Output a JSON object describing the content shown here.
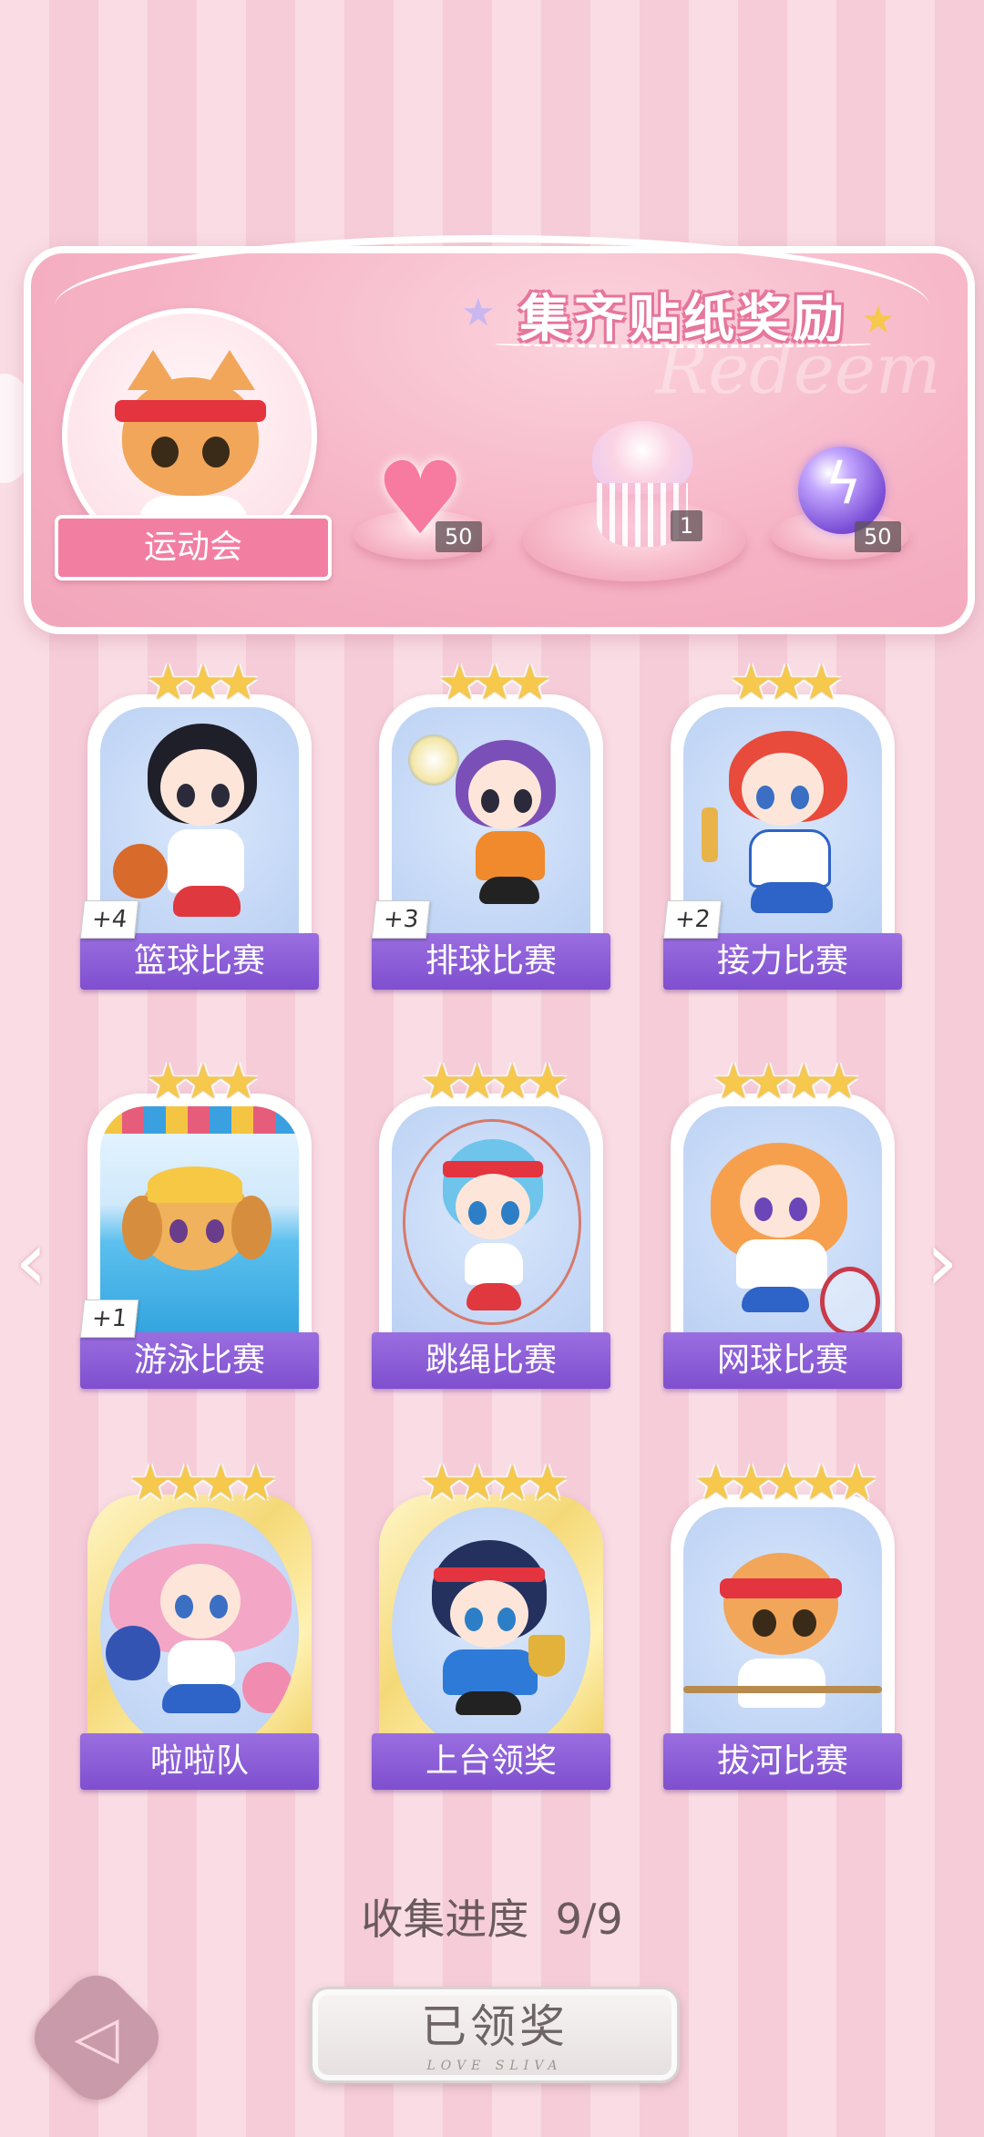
{
  "banner": {
    "title": "集齐贴纸奖励",
    "watermark": "Redeem",
    "event_label": "运动会",
    "rewards": [
      {
        "icon": "pink-heart-gem-icon",
        "count": "50"
      },
      {
        "icon": "jellyfish-ornament-icon",
        "count": "1"
      },
      {
        "icon": "purple-lightning-orb-icon",
        "count": "50"
      }
    ]
  },
  "cards": [
    {
      "title": "篮球比赛",
      "stars": "★★★",
      "bonus": "+4",
      "art": "basketball-girl"
    },
    {
      "title": "排球比赛",
      "stars": "★★★",
      "bonus": "+3",
      "art": "volleyball-girl"
    },
    {
      "title": "接力比赛",
      "stars": "★★★",
      "bonus": "+2",
      "art": "relay-girl"
    },
    {
      "title": "游泳比赛",
      "stars": "★★★",
      "bonus": "+1",
      "art": "swimming-dog"
    },
    {
      "title": "跳绳比赛",
      "stars": "★★★★",
      "bonus": "",
      "art": "jump-rope-girl"
    },
    {
      "title": "网球比赛",
      "stars": "★★★★",
      "bonus": "",
      "art": "tennis-girl"
    },
    {
      "title": "啦啦队",
      "stars": "★★★★",
      "bonus": "",
      "art": "cheerleader-girl"
    },
    {
      "title": "上台领奖",
      "stars": "★★★★",
      "bonus": "",
      "art": "trophy-girl"
    },
    {
      "title": "拔河比赛",
      "stars": "★★★★★",
      "bonus": "",
      "art": "tug-of-war-cat"
    }
  ],
  "progress": {
    "label": "收集进度",
    "value": "9/9"
  },
  "claim_button": {
    "label": "已领奖",
    "sub": "LOVE SLIVA"
  },
  "colors": {
    "ribbon": "#8a5ad6",
    "banner": "#f6b3c5",
    "star": "#f6c84b",
    "bg_stripe": "#f5ccd8"
  }
}
